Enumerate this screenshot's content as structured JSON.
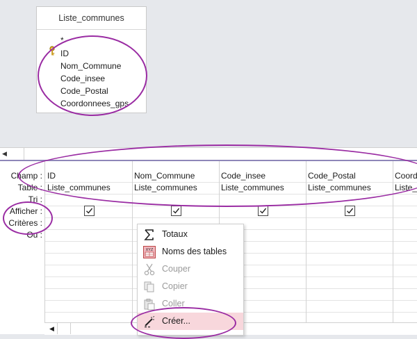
{
  "table_box": {
    "title": "Liste_communes",
    "fields": [
      "*",
      "ID",
      "Nom_Commune",
      "Code_insee",
      "Code_Postal",
      "Coordonnees_gps"
    ]
  },
  "query_grid": {
    "row_labels": [
      "Champ :",
      "Table :",
      "Tri :",
      "Afficher :",
      "Critères :",
      "Ou :"
    ],
    "columns": [
      {
        "field": "ID",
        "table": "Liste_communes",
        "show": true
      },
      {
        "field": "Nom_Commune",
        "table": "Liste_communes",
        "show": true
      },
      {
        "field": "Code_insee",
        "table": "Liste_communes",
        "show": true
      },
      {
        "field": "Code_Postal",
        "table": "Liste_communes",
        "show": true
      },
      {
        "field": "Coordo",
        "table": "Liste_c",
        "show": false
      }
    ]
  },
  "context_menu": {
    "items": [
      {
        "label": "Totaux",
        "icon": "sigma-icon",
        "enabled": true,
        "underline": "x"
      },
      {
        "label": "Noms des tables",
        "icon": "table-names-icon",
        "enabled": true,
        "underline": "N"
      },
      {
        "label": "Couper",
        "icon": "scissors-icon",
        "enabled": false,
        "underline": "p"
      },
      {
        "label": "Copier",
        "icon": "copy-icon",
        "enabled": false,
        "underline": "C"
      },
      {
        "label": "Coller",
        "icon": "paste-icon",
        "enabled": false,
        "underline": "o"
      },
      {
        "label": "Créer...",
        "icon": "builder-wand-icon",
        "enabled": true,
        "underline": "é",
        "highlighted": true
      }
    ]
  },
  "colors": {
    "annotation": "#9a2ca3",
    "menu_highlight": "#f8d7dc",
    "splitter": "#8e86b8"
  }
}
